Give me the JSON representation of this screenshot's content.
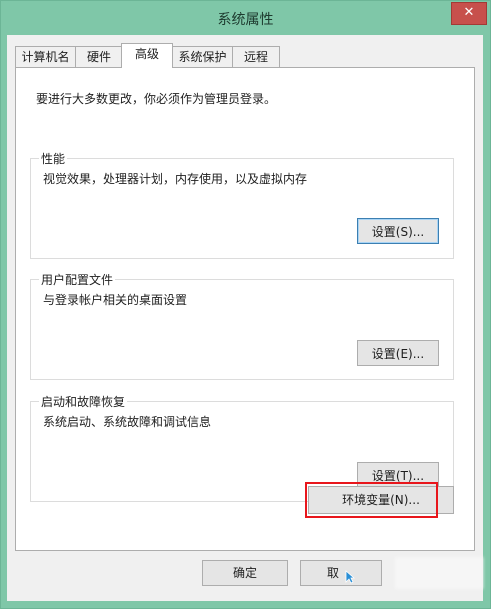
{
  "window": {
    "title": "系统属性",
    "close_label": "✕"
  },
  "tabs": [
    {
      "label": "计算机名",
      "active": false
    },
    {
      "label": "硬件",
      "active": false
    },
    {
      "label": "高级",
      "active": true
    },
    {
      "label": "系统保护",
      "active": false
    },
    {
      "label": "远程",
      "active": false
    }
  ],
  "advanced": {
    "admin_note": "要进行大多数更改，你必须作为管理员登录。",
    "performance": {
      "title": "性能",
      "description": "视觉效果，处理器计划，内存使用，以及虚拟内存",
      "button": "设置(S)..."
    },
    "user_profiles": {
      "title": "用户配置文件",
      "description": "与登录帐户相关的桌面设置",
      "button": "设置(E)..."
    },
    "startup_recovery": {
      "title": "启动和故障恢复",
      "description": "系统启动、系统故障和调试信息",
      "button": "设置(T)..."
    },
    "env_button": "环境变量(N)..."
  },
  "footer": {
    "ok": "确定",
    "cancel": "取"
  },
  "colors": {
    "titlebar": "#7fc7a8",
    "close": "#c7504c",
    "highlight": "#e8161c"
  }
}
